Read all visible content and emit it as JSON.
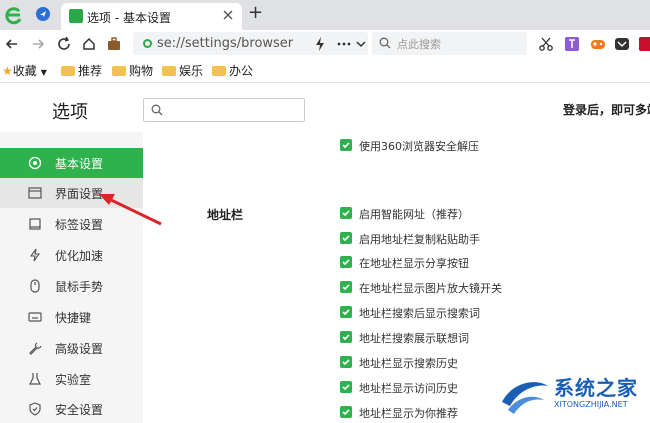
{
  "browser": {
    "tab_title": "选项 - 基本设置",
    "new_tab_glyph": "+",
    "address_url": "se://settings/browser",
    "search_placeholder": "点此搜索"
  },
  "bookmarks": [
    {
      "label": "收藏"
    },
    {
      "label": "推荐"
    },
    {
      "label": "购物"
    },
    {
      "label": "娱乐"
    },
    {
      "label": "办公"
    }
  ],
  "settings": {
    "title": "选项",
    "login_hint": "登录后，即可多端"
  },
  "sidebar": {
    "items": [
      {
        "label": "基本设置",
        "icon": "target-icon"
      },
      {
        "label": "界面设置",
        "icon": "window-icon"
      },
      {
        "label": "标签设置",
        "icon": "tab-icon"
      },
      {
        "label": "优化加速",
        "icon": "lightning-icon"
      },
      {
        "label": "鼠标手势",
        "icon": "mouse-icon"
      },
      {
        "label": "快捷键",
        "icon": "keyboard-icon"
      },
      {
        "label": "高级设置",
        "icon": "wrench-icon"
      },
      {
        "label": "实验室",
        "icon": "lab-icon"
      },
      {
        "label": "安全设置",
        "icon": "shield-icon"
      }
    ]
  },
  "content": {
    "top_option": "使用360浏览器安全解压",
    "section_label": "地址栏",
    "options": [
      "启用智能网址（推荐）",
      "启用地址栏复制粘贴助手",
      "在地址栏显示分享按钮",
      "在地址栏显示图片放大镜开关",
      "地址栏搜索后显示搜索词",
      "地址栏搜索展示联想词",
      "地址栏显示搜索历史",
      "地址栏显示访问历史",
      "地址栏显示为你推荐"
    ]
  },
  "watermark": {
    "main": "系统之家",
    "sub": "XITONGZHIJIA.NET"
  },
  "colors": {
    "accent": "#2fb14e",
    "tab_strip": "#dfe1e5",
    "annotation_arrow": "#d9252a",
    "watermark": "#1a5fb4"
  }
}
